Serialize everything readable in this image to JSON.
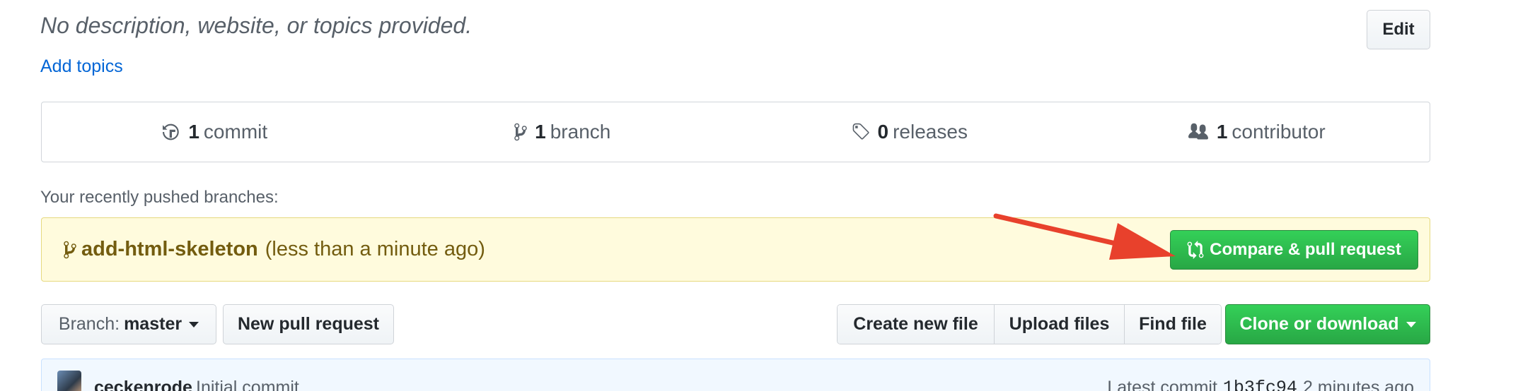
{
  "repo": {
    "description": "No description, website, or topics provided.",
    "add_topics": "Add topics",
    "edit_label": "Edit"
  },
  "numbers": [
    {
      "icon": "history-icon",
      "count": "1",
      "label": "commit"
    },
    {
      "icon": "branch-icon",
      "count": "1",
      "label": "branch"
    },
    {
      "icon": "tag-icon",
      "count": "0",
      "label": "releases"
    },
    {
      "icon": "people-icon",
      "count": "1",
      "label": "contributor"
    }
  ],
  "recent": {
    "heading": "Your recently pushed branches:",
    "branch": "add-html-skeleton",
    "time": "(less than a minute ago)",
    "compare_label": "Compare & pull request"
  },
  "toolbar": {
    "branch_prefix": "Branch:",
    "branch_name": "master",
    "new_pr": "New pull request",
    "create_file": "Create new file",
    "upload_files": "Upload files",
    "find_file": "Find file",
    "clone": "Clone or download"
  },
  "commit": {
    "author": "ceckenrode",
    "message": "Initial commit",
    "latest_prefix": "Latest commit",
    "sha": "1b3fc94",
    "time": "2 minutes ago"
  },
  "colors": {
    "link": "#0366d6",
    "primary_green": "#28a745",
    "flash_bg": "#fffbdd",
    "annotation_arrow": "#e8412c"
  }
}
